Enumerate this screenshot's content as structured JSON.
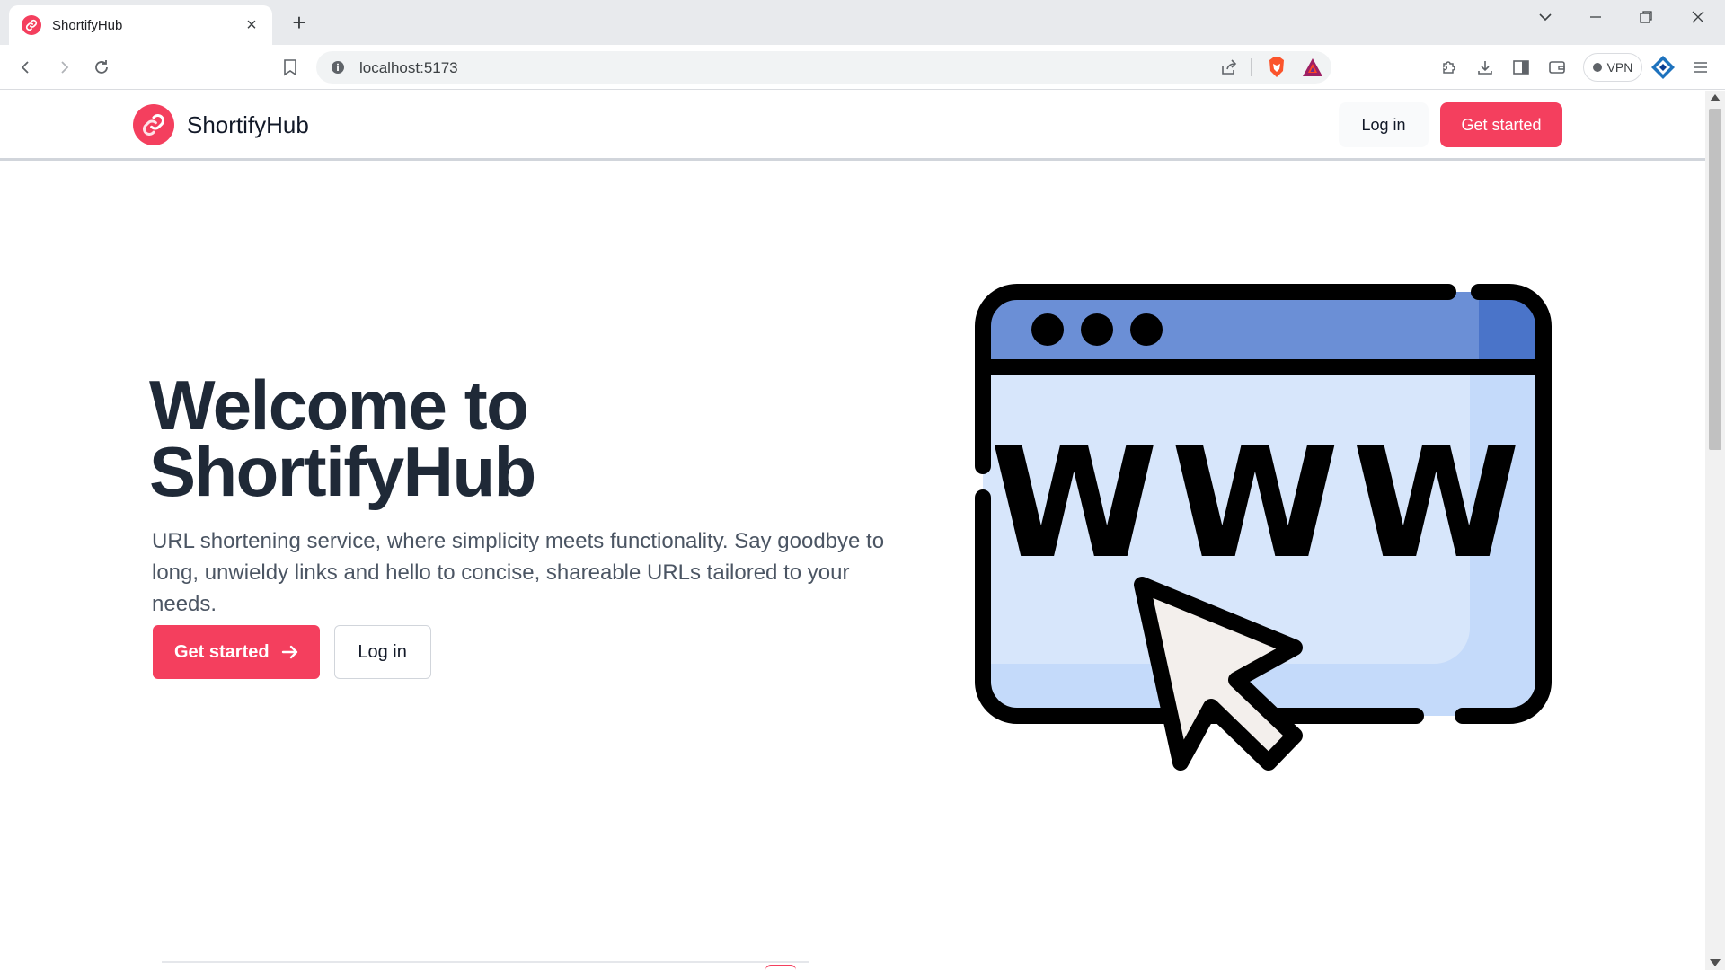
{
  "browser": {
    "tab_title": "ShortifyHub",
    "url": "localhost:5173",
    "vpn_label": "VPN",
    "icons": {
      "back": "back-arrow-icon",
      "forward": "forward-arrow-icon",
      "reload": "reload-icon",
      "bookmark": "bookmark-icon",
      "info": "info-icon",
      "share": "share-icon",
      "brave": "brave-shield-icon",
      "rewards": "brave-rewards-icon"
    }
  },
  "navbar": {
    "brand_name": "ShortifyHub",
    "login_label": "Log in",
    "get_started_label": "Get started"
  },
  "hero": {
    "title_line1": "Welcome to",
    "title_line2": "ShortifyHub",
    "description": "URL shortening service, where simplicity meets functionality. Say goodbye to long, unwieldy links and hello to concise, shareable URLs tailored to your needs.",
    "primary_button": "Get started",
    "secondary_button": "Log in",
    "illustration_text": "WWW"
  },
  "colors": {
    "accent": "#f43f5e",
    "heading": "#1f2937",
    "body_text": "#4b5563",
    "window_header": "#6b8fd6",
    "window_body": "#d7e6fb"
  }
}
